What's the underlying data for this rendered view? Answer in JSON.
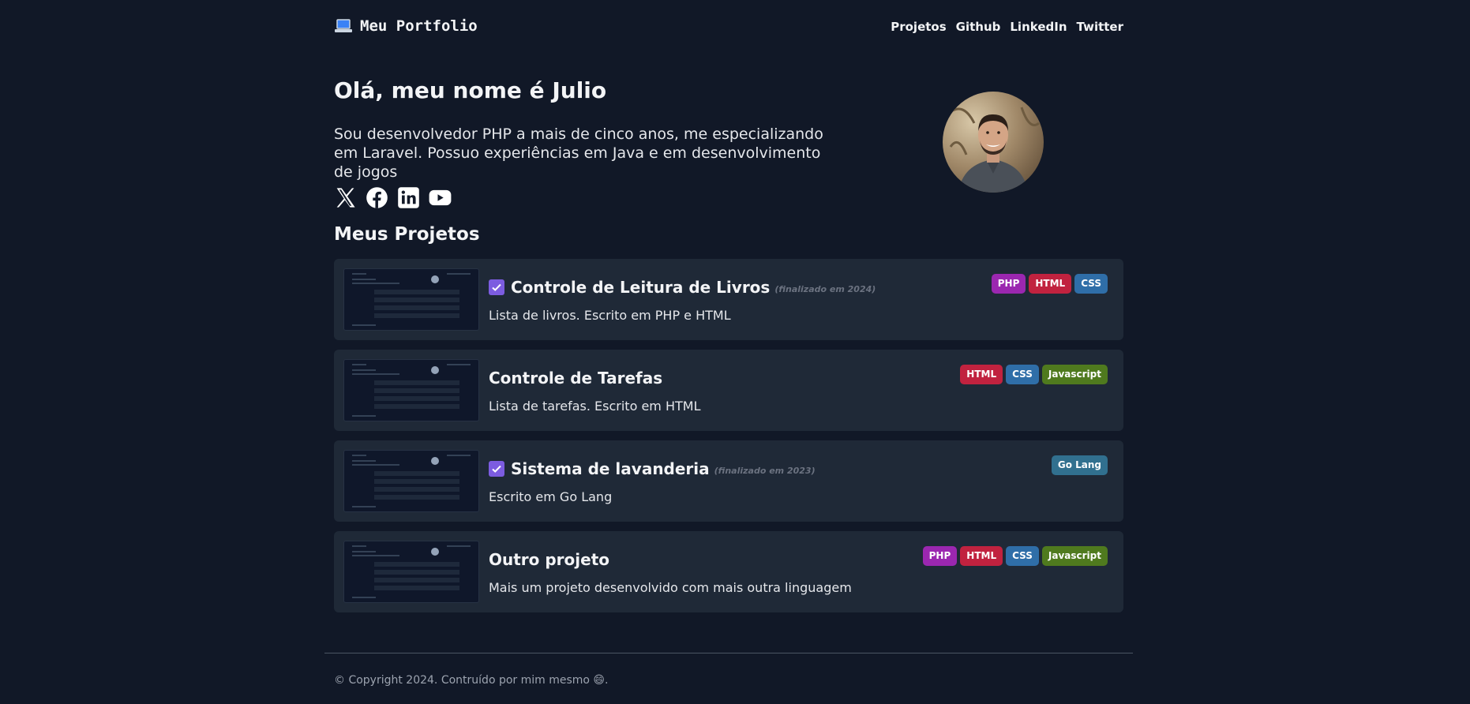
{
  "header": {
    "brand_icon": "laptop-icon",
    "brand": "Meu Portfolio",
    "nav": [
      "Projetos",
      "Github",
      "LinkedIn",
      "Twitter"
    ]
  },
  "hero": {
    "title": "Olá, meu nome é Julio",
    "bio": "Sou desenvolvedor PHP a mais de cinco anos, me especializando em Laravel. Possuo experiências em Java e em desenvolvimento de jogos",
    "socials": [
      "x-icon",
      "facebook-icon",
      "linkedin-icon",
      "youtube-icon"
    ]
  },
  "projects_section": {
    "title": "Meus Projetos",
    "projects": [
      {
        "title": "Controle de Leitura de Livros",
        "status": "(finalizado em 2024)",
        "done": true,
        "description": "Lista de livros. Escrito em PHP e HTML",
        "tags": [
          "PHP",
          "HTML",
          "CSS"
        ]
      },
      {
        "title": "Controle de Tarefas",
        "status": "",
        "done": false,
        "description": "Lista de tarefas. Escrito em HTML",
        "tags": [
          "HTML",
          "CSS",
          "Javascript"
        ]
      },
      {
        "title": "Sistema de lavanderia",
        "status": "(finalizado em 2023)",
        "done": true,
        "description": "Escrito em Go Lang",
        "tags": [
          "Go Lang"
        ]
      },
      {
        "title": "Outro projeto",
        "status": "",
        "done": false,
        "description": "Mais um projeto desenvolvido com mais outra linguagem",
        "tags": [
          "PHP",
          "HTML",
          "CSS",
          "Javascript"
        ]
      }
    ]
  },
  "tag_colors": {
    "PHP": "#9b27b0",
    "HTML": "#c1223f",
    "CSS": "#2f6ea8",
    "Javascript": "#4f7a1e",
    "Go Lang": "#31708f"
  },
  "footer": {
    "text": "© Copyright 2024. Contruído por mim mesmo 😄."
  }
}
